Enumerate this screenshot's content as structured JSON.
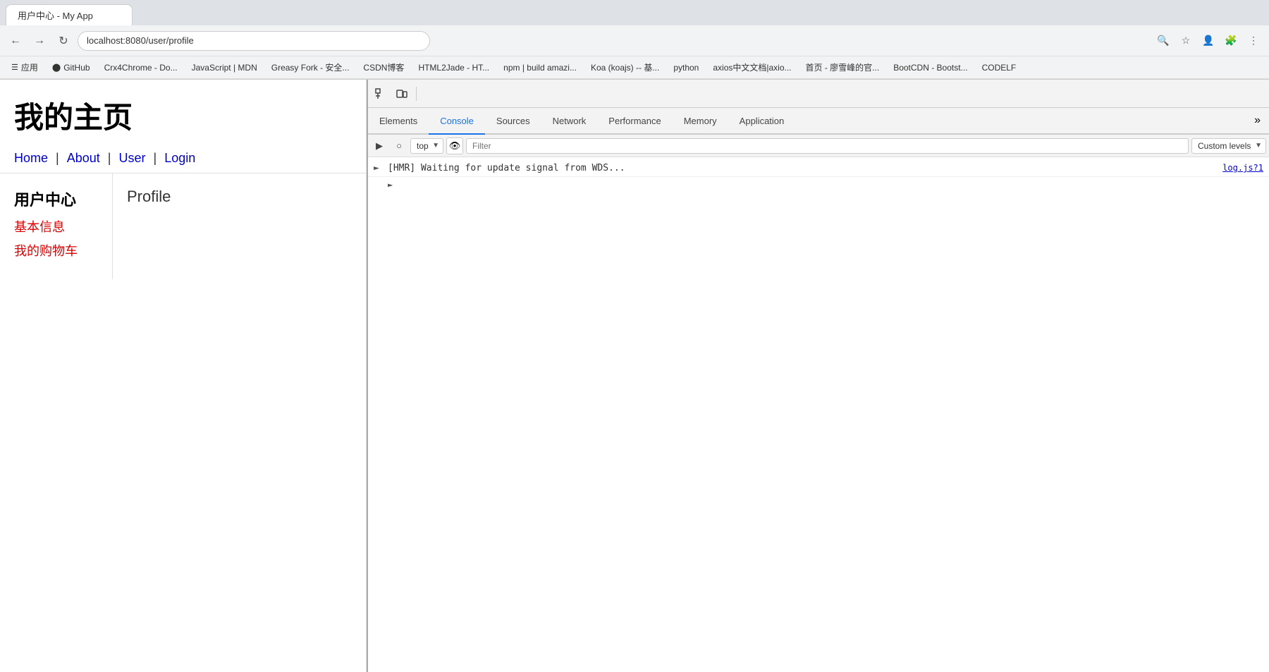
{
  "browser": {
    "tab_title": "用户中心 - My App",
    "url": "localhost:8080/user/profile"
  },
  "bookmarks": [
    {
      "label": "应用",
      "icon": "☰"
    },
    {
      "label": "GitHub",
      "icon": "⬤"
    },
    {
      "label": "Crx4Chrome - Do...",
      "icon": "C"
    },
    {
      "label": "JavaScript | MDN",
      "icon": "🔷"
    },
    {
      "label": "Greasy Fork - 安全...",
      "icon": "🟢"
    },
    {
      "label": "CSDN博客",
      "icon": "C"
    },
    {
      "label": "HTML2Jade - HT...",
      "icon": "H"
    },
    {
      "label": "npm | build amazi...",
      "icon": "n"
    },
    {
      "label": "Koa (koajs) -- 基...",
      "icon": "K"
    },
    {
      "label": "python",
      "icon": "🐍"
    },
    {
      "label": "axios中文文档|axio...",
      "icon": "a"
    },
    {
      "label": "首页 - 廖雪峰的官...",
      "icon": "廖"
    },
    {
      "label": "BootCDN - Bootst...",
      "icon": "B"
    },
    {
      "label": "CODELF",
      "icon": "C"
    }
  ],
  "website": {
    "title": "我的主页",
    "nav": {
      "items": [
        {
          "label": "Home",
          "href": "#"
        },
        {
          "label": "About",
          "href": "#"
        },
        {
          "label": "User",
          "href": "#"
        },
        {
          "label": "Login",
          "href": "#"
        }
      ],
      "separators": [
        "|",
        "|",
        "|"
      ]
    },
    "sidebar": {
      "title": "用户中心",
      "links": [
        {
          "label": "基本信息",
          "href": "#"
        },
        {
          "label": "我的购物车",
          "href": "#"
        }
      ]
    },
    "main": {
      "content": "Profile"
    }
  },
  "devtools": {
    "tabs": [
      {
        "label": "Elements",
        "active": false
      },
      {
        "label": "Console",
        "active": true
      },
      {
        "label": "Sources",
        "active": false
      },
      {
        "label": "Network",
        "active": false
      },
      {
        "label": "Performance",
        "active": false
      },
      {
        "label": "Memory",
        "active": false
      },
      {
        "label": "Application",
        "active": false
      }
    ],
    "console": {
      "context_select": "top",
      "filter_placeholder": "Filter",
      "custom_levels_label": "Custom levels",
      "log_message": "[HMR] Waiting for update signal from WDS...",
      "log_file": "log.js?1"
    }
  }
}
